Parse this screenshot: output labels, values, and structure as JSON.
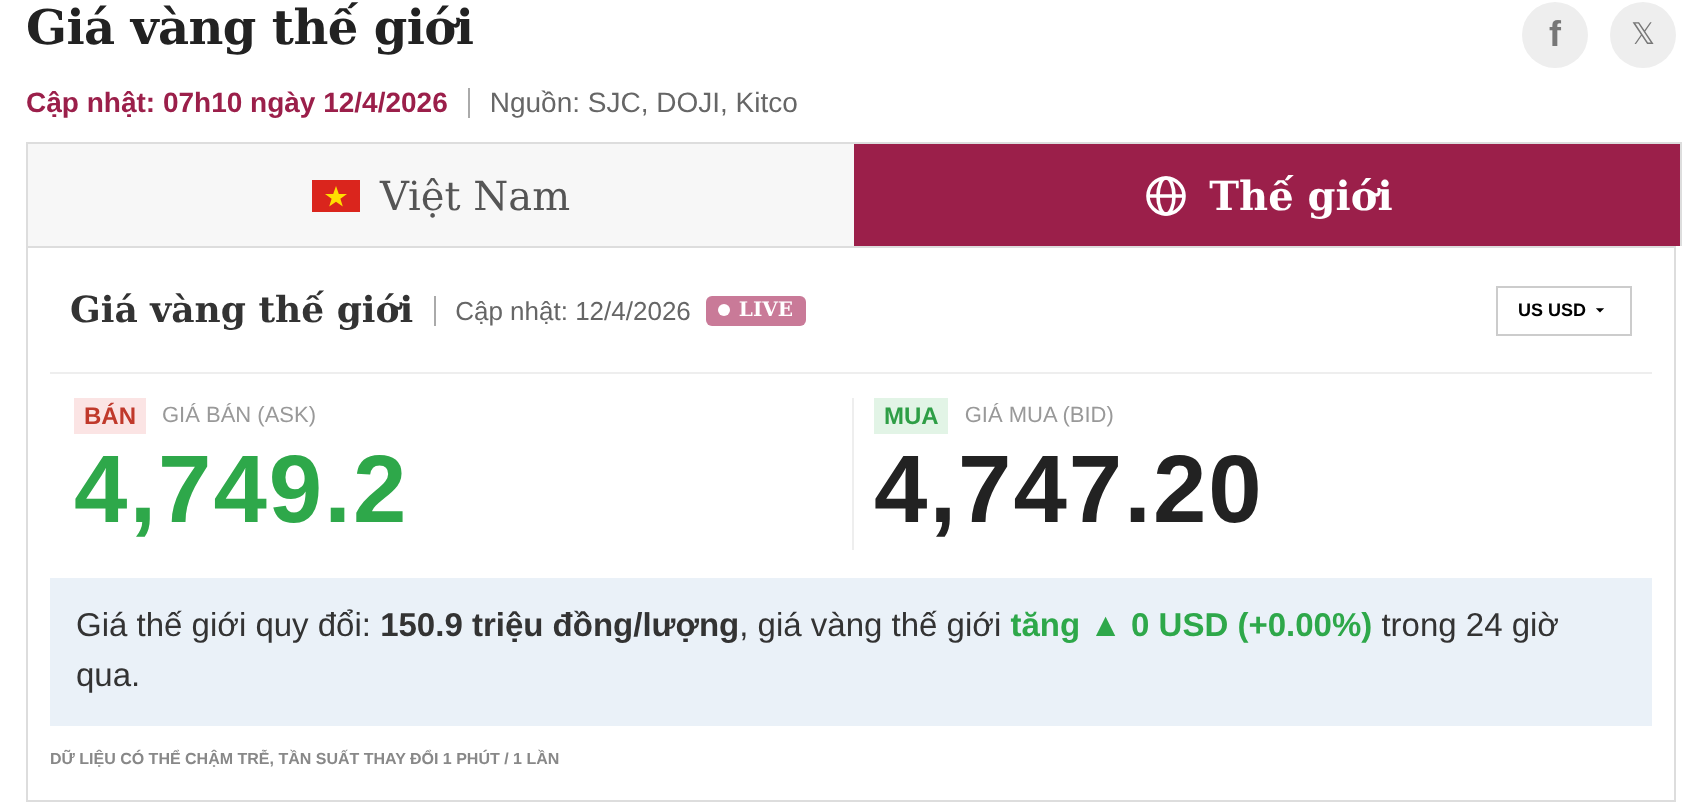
{
  "title": "Giá vàng thế giới",
  "social": [
    {
      "kind": "facebook",
      "label": "f"
    },
    {
      "kind": "x",
      "label": "𝕏"
    }
  ],
  "meta": {
    "updated": "Cập nhật: 07h10 ngày 12/4/2026",
    "source": "Nguồn: SJC, DOJI, Kitco"
  },
  "tabs": [
    {
      "label": "Việt Nam",
      "kind": "flag",
      "selected": false
    },
    {
      "label": "Thế giới",
      "kind": "globe",
      "selected": true
    }
  ],
  "card": {
    "title": "Giá vàng thế giới",
    "updated": "Cập nhật: 12/4/2026",
    "live": "LIVE",
    "currency": "US USD"
  },
  "prices": [
    {
      "kind": "sell",
      "badge": "BÁN",
      "label": "GIÁ BÁN (ASK)",
      "value": "4,749.2"
    },
    {
      "kind": "buy",
      "badge": "MUA",
      "label": "GIÁ MUA (BID)",
      "value": "4,747.20"
    }
  ],
  "summary": [
    {
      "kind": "plain",
      "text": "Giá thế giới quy đổi: "
    },
    {
      "kind": "bold",
      "text": "150.9 triệu đồng/lượng"
    },
    {
      "kind": "plain",
      "text": ", giá vàng thế giới "
    },
    {
      "kind": "up",
      "text": "tăng ▲ 0 USD (+0.00%)"
    },
    {
      "kind": "plain",
      "text": " trong 24 giờ qua."
    }
  ],
  "note": "DỮ LIỆU CÓ THỂ CHẬM TRỄ, TẦN SUẤT THAY ĐỔI 1 PHÚT / 1 LẦN"
}
